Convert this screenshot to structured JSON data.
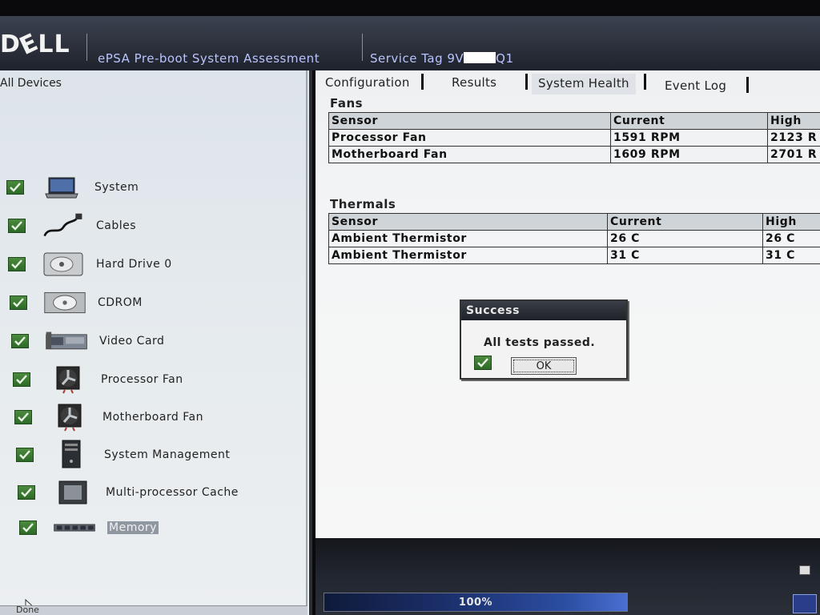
{
  "header": {
    "logo": "D∈LL",
    "app_title": "ePSA Pre-boot System Assessment",
    "service_tag_prefix": "Service Tag 9V",
    "service_tag_suffix": "Q1"
  },
  "left": {
    "title": "All Devices",
    "devices": [
      {
        "label": "System",
        "icon": "laptop-icon",
        "checked": true
      },
      {
        "label": "Cables",
        "icon": "cable-icon",
        "checked": true
      },
      {
        "label": "Hard Drive 0",
        "icon": "hard-drive-icon",
        "checked": true
      },
      {
        "label": "CDROM",
        "icon": "cdrom-icon",
        "checked": true
      },
      {
        "label": "Video Card",
        "icon": "video-card-icon",
        "checked": true
      },
      {
        "label": "Processor Fan",
        "icon": "fan-icon",
        "checked": true
      },
      {
        "label": "Motherboard Fan",
        "icon": "fan-icon",
        "checked": true
      },
      {
        "label": "System Management",
        "icon": "tower-icon",
        "checked": true
      },
      {
        "label": "Multi-processor Cache",
        "icon": "chip-icon",
        "checked": true
      },
      {
        "label": "Memory",
        "icon": "memory-icon",
        "checked": true,
        "selected": true
      }
    ],
    "status_left": "Done"
  },
  "tabs": [
    "Configuration",
    "Results",
    "System Health",
    "Event Log"
  ],
  "active_tab": "System Health",
  "fans": {
    "title": "Fans",
    "columns": [
      "Sensor",
      "Current",
      "High"
    ],
    "rows": [
      [
        "Processor Fan",
        "1591 RPM",
        "2123 R"
      ],
      [
        "Motherboard Fan",
        "1609 RPM",
        "2701 R"
      ]
    ]
  },
  "thermals": {
    "title": "Thermals",
    "columns": [
      "Sensor",
      "Current",
      "High"
    ],
    "rows": [
      [
        "Ambient Thermistor",
        "26 C",
        "26 C"
      ],
      [
        "Ambient Thermistor",
        "31 C",
        "31 C"
      ]
    ]
  },
  "dialog": {
    "title": "Success",
    "message": "All tests passed.",
    "ok_label": "OK"
  },
  "progress": {
    "value": 1.0,
    "label": "100%"
  },
  "colors": {
    "header_text": "#b9c4ff",
    "check_green": "#3f7d34",
    "progress_blue": "#2c4ea3"
  }
}
